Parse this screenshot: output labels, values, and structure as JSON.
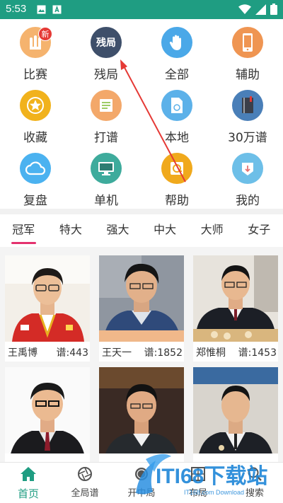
{
  "status": {
    "time": "5:53"
  },
  "menu": [
    {
      "label": "比赛",
      "icon": "trophy-icon",
      "color": "#f5b36e",
      "badge": "新"
    },
    {
      "label": "残局",
      "icon": "endgame-icon",
      "color": "#3e4f6a",
      "glyph": "残局"
    },
    {
      "label": "全部",
      "icon": "hand-icon",
      "color": "#4aa8e8"
    },
    {
      "label": "辅助",
      "icon": "phone-icon",
      "color": "#ef9552"
    },
    {
      "label": "收藏",
      "icon": "star-icon",
      "color": "#f1b21c"
    },
    {
      "label": "打谱",
      "icon": "notebook-icon",
      "color": "#f3a86a"
    },
    {
      "label": "本地",
      "icon": "local-file-icon",
      "color": "#5cb1e9"
    },
    {
      "label": "30万谱",
      "icon": "book-icon",
      "color": "#4a7fb8"
    },
    {
      "label": "复盘",
      "icon": "cloud-icon",
      "color": "#4bb2f0"
    },
    {
      "label": "单机",
      "icon": "monitor-icon",
      "color": "#3eab9c"
    },
    {
      "label": "帮助",
      "icon": "help-icon",
      "color": "#f0a91c"
    },
    {
      "label": "我的",
      "icon": "my-icon",
      "color": "#6dbfe8"
    }
  ],
  "tabs": [
    "冠军",
    "特大",
    "强大",
    "中大",
    "大师",
    "女子"
  ],
  "players": [
    {
      "name": "王禹博",
      "count": "谱:443"
    },
    {
      "name": "王天一",
      "count": "谱:1852"
    },
    {
      "name": "郑惟桐",
      "count": "谱:1453"
    },
    {
      "name": "",
      "count": ""
    },
    {
      "name": "",
      "count": ""
    },
    {
      "name": "",
      "count": ""
    }
  ],
  "bottom_nav": [
    {
      "label": "首页",
      "icon": "home-icon"
    },
    {
      "label": "全局谱",
      "icon": "aperture-icon"
    },
    {
      "label": "开中局",
      "icon": "chess-piece-icon"
    },
    {
      "label": "布局",
      "icon": "layout-icon"
    },
    {
      "label": "搜索",
      "icon": "search-icon"
    }
  ],
  "watermark": {
    "text": "ITI68下载站",
    "sub": "IT168.com Download"
  }
}
